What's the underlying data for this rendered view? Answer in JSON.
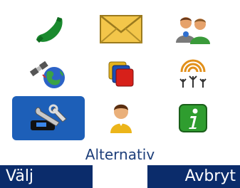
{
  "menu": {
    "title": "Alternativ",
    "selected_index": 6,
    "items": [
      {
        "icon": "phone-icon"
      },
      {
        "icon": "envelope-icon"
      },
      {
        "icon": "contacts-icon"
      },
      {
        "icon": "satellite-globe-icon"
      },
      {
        "icon": "colored-squares-icon"
      },
      {
        "icon": "antenna-network-icon"
      },
      {
        "icon": "tools-icon"
      },
      {
        "icon": "person-icon"
      },
      {
        "icon": "info-icon"
      }
    ]
  },
  "softkeys": {
    "left_label": "Välj",
    "right_label": "Avbryt"
  },
  "colors": {
    "selection": "#1d5fb8",
    "softkey_bg": "#0b2c6b",
    "title_text": "#1e3f7a"
  }
}
